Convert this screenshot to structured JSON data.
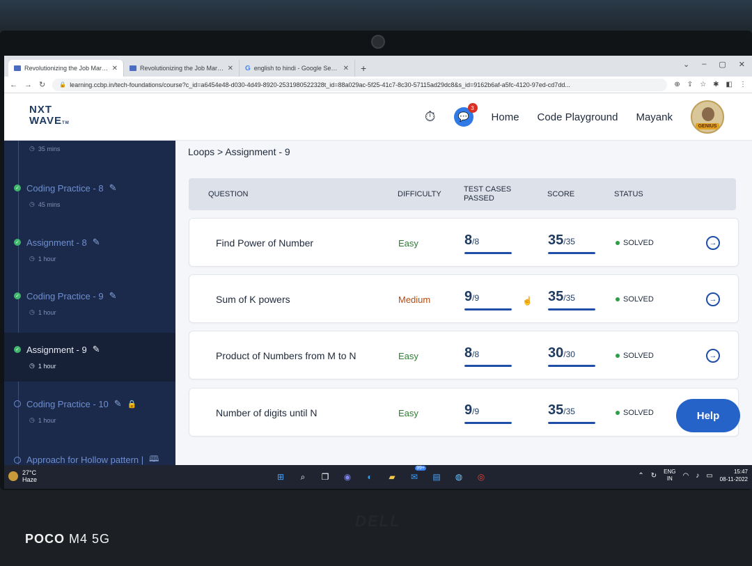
{
  "browser": {
    "tabs": [
      {
        "title": "Revolutionizing the Job Market |",
        "active": true
      },
      {
        "title": "Revolutionizing the Job Market |",
        "active": false
      },
      {
        "title": "english to hindi - Google Search",
        "active": false
      }
    ],
    "new_tab": "+",
    "url": "learning.ccbp.in/tech-foundations/course?c_id=a6454e48-d030-4d49-8920-2531980522328t_id=88a029ac-5f25-41c7-8c30-57115ad29dc8&s_id=9162b6af-a5fc-4120-97ed-cd7dd..."
  },
  "header": {
    "logo_line1": "NXT",
    "logo_line2": "WAVE",
    "logo_tm": "TM",
    "notification_count": "3",
    "nav_home": "Home",
    "nav_playground": "Code Playground",
    "user_name": "Mayank",
    "avatar_badge": "GENIUS"
  },
  "sidebar": {
    "items": [
      {
        "title": "",
        "sub": "35 mins",
        "status": "done"
      },
      {
        "title": "Coding Practice - 8",
        "sub": "45 mins",
        "status": "done"
      },
      {
        "title": "Assignment - 8",
        "sub": "1 hour",
        "status": "done"
      },
      {
        "title": "Coding Practice - 9",
        "sub": "1 hour",
        "status": "done"
      },
      {
        "title": "Assignment - 9",
        "sub": "1 hour",
        "status": "done",
        "current": true
      },
      {
        "title": "Coding Practice - 10",
        "sub": "1 hour",
        "status": "locked"
      },
      {
        "title": "Approach for Hollow pattern |",
        "sub": "",
        "status": "pending"
      }
    ]
  },
  "breadcrumb": "Loops > Assignment - 9",
  "table": {
    "headers": {
      "question": "QUESTION",
      "difficulty": "DIFFICULTY",
      "tests_line1": "TEST CASES",
      "tests_line2": "PASSED",
      "score": "SCORE",
      "status": "STATUS"
    },
    "rows": [
      {
        "question": "Find Power of Number",
        "difficulty": "Easy",
        "tests": "8",
        "tests_total": "/8",
        "score": "35",
        "score_total": "/35",
        "status": "SOLVED",
        "progress": 1.0
      },
      {
        "question": "Sum of K powers",
        "difficulty": "Medium",
        "tests": "9",
        "tests_total": "/9",
        "score": "35",
        "score_total": "/35",
        "status": "SOLVED",
        "progress": 1.0
      },
      {
        "question": "Product of Numbers from M to N",
        "difficulty": "Easy",
        "tests": "8",
        "tests_total": "/8",
        "score": "30",
        "score_total": "/30",
        "status": "SOLVED",
        "progress": 1.0
      },
      {
        "question": "Number of digits until N",
        "difficulty": "Easy",
        "tests": "9",
        "tests_total": "/9",
        "score": "35",
        "score_total": "/35",
        "status": "SOLVED",
        "progress": 1.0
      }
    ]
  },
  "help_label": "Help",
  "taskbar": {
    "temp": "27°C",
    "weather": "Haze",
    "lang_line1": "ENG",
    "lang_line2": "IN",
    "time": "15:47",
    "date": "08-11-2022",
    "app_badge": "99+"
  },
  "device": {
    "brand": "DELL",
    "watermark_bold": "POCO",
    "watermark_rest": "M4 5G"
  },
  "colors": {
    "sidebar_bg": "#1b2a4a",
    "accent": "#1f4ea8",
    "easy": "#2e7d32",
    "medium": "#b24a10",
    "solved_dot": "#2e9d48",
    "help_button": "#2563c9"
  }
}
